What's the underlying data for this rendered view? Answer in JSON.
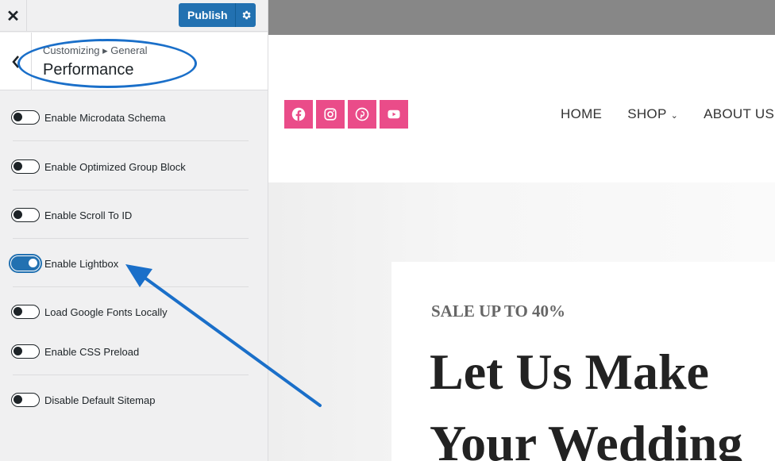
{
  "sidebar": {
    "close_glyph": "✕",
    "publish_label": "Publish",
    "breadcrumb": "Customizing ▸ General",
    "section_title": "Performance",
    "controls": [
      {
        "label": "Enable Microdata Schema",
        "enabled": false
      },
      {
        "label": "Enable Optimized Group Block",
        "enabled": false
      },
      {
        "label": "Enable Scroll To ID",
        "enabled": false
      },
      {
        "label": "Enable Lightbox",
        "enabled": true
      },
      {
        "label": "Load Google Fonts Locally",
        "enabled": false
      },
      {
        "label": "Enable CSS Preload",
        "enabled": false
      },
      {
        "label": "Disable Default Sitemap",
        "enabled": false
      }
    ]
  },
  "preview": {
    "social_icons": [
      "facebook-icon",
      "instagram-icon",
      "pinterest-icon",
      "youtube-icon"
    ],
    "nav": [
      {
        "label": "HOME"
      },
      {
        "label": "SHOP",
        "has_dropdown": true,
        "chevron": "⌄"
      },
      {
        "label": "ABOUT US"
      }
    ],
    "hero": {
      "sale_text": "SALE UP TO 40%",
      "heading_line1": "Let Us Make",
      "heading_line2": "Your Wedding"
    }
  },
  "colors": {
    "accent": "#2271b1",
    "social_pink": "#ea4c89",
    "annotation_blue": "#1a6fc9",
    "admin_bar": "#878787"
  }
}
